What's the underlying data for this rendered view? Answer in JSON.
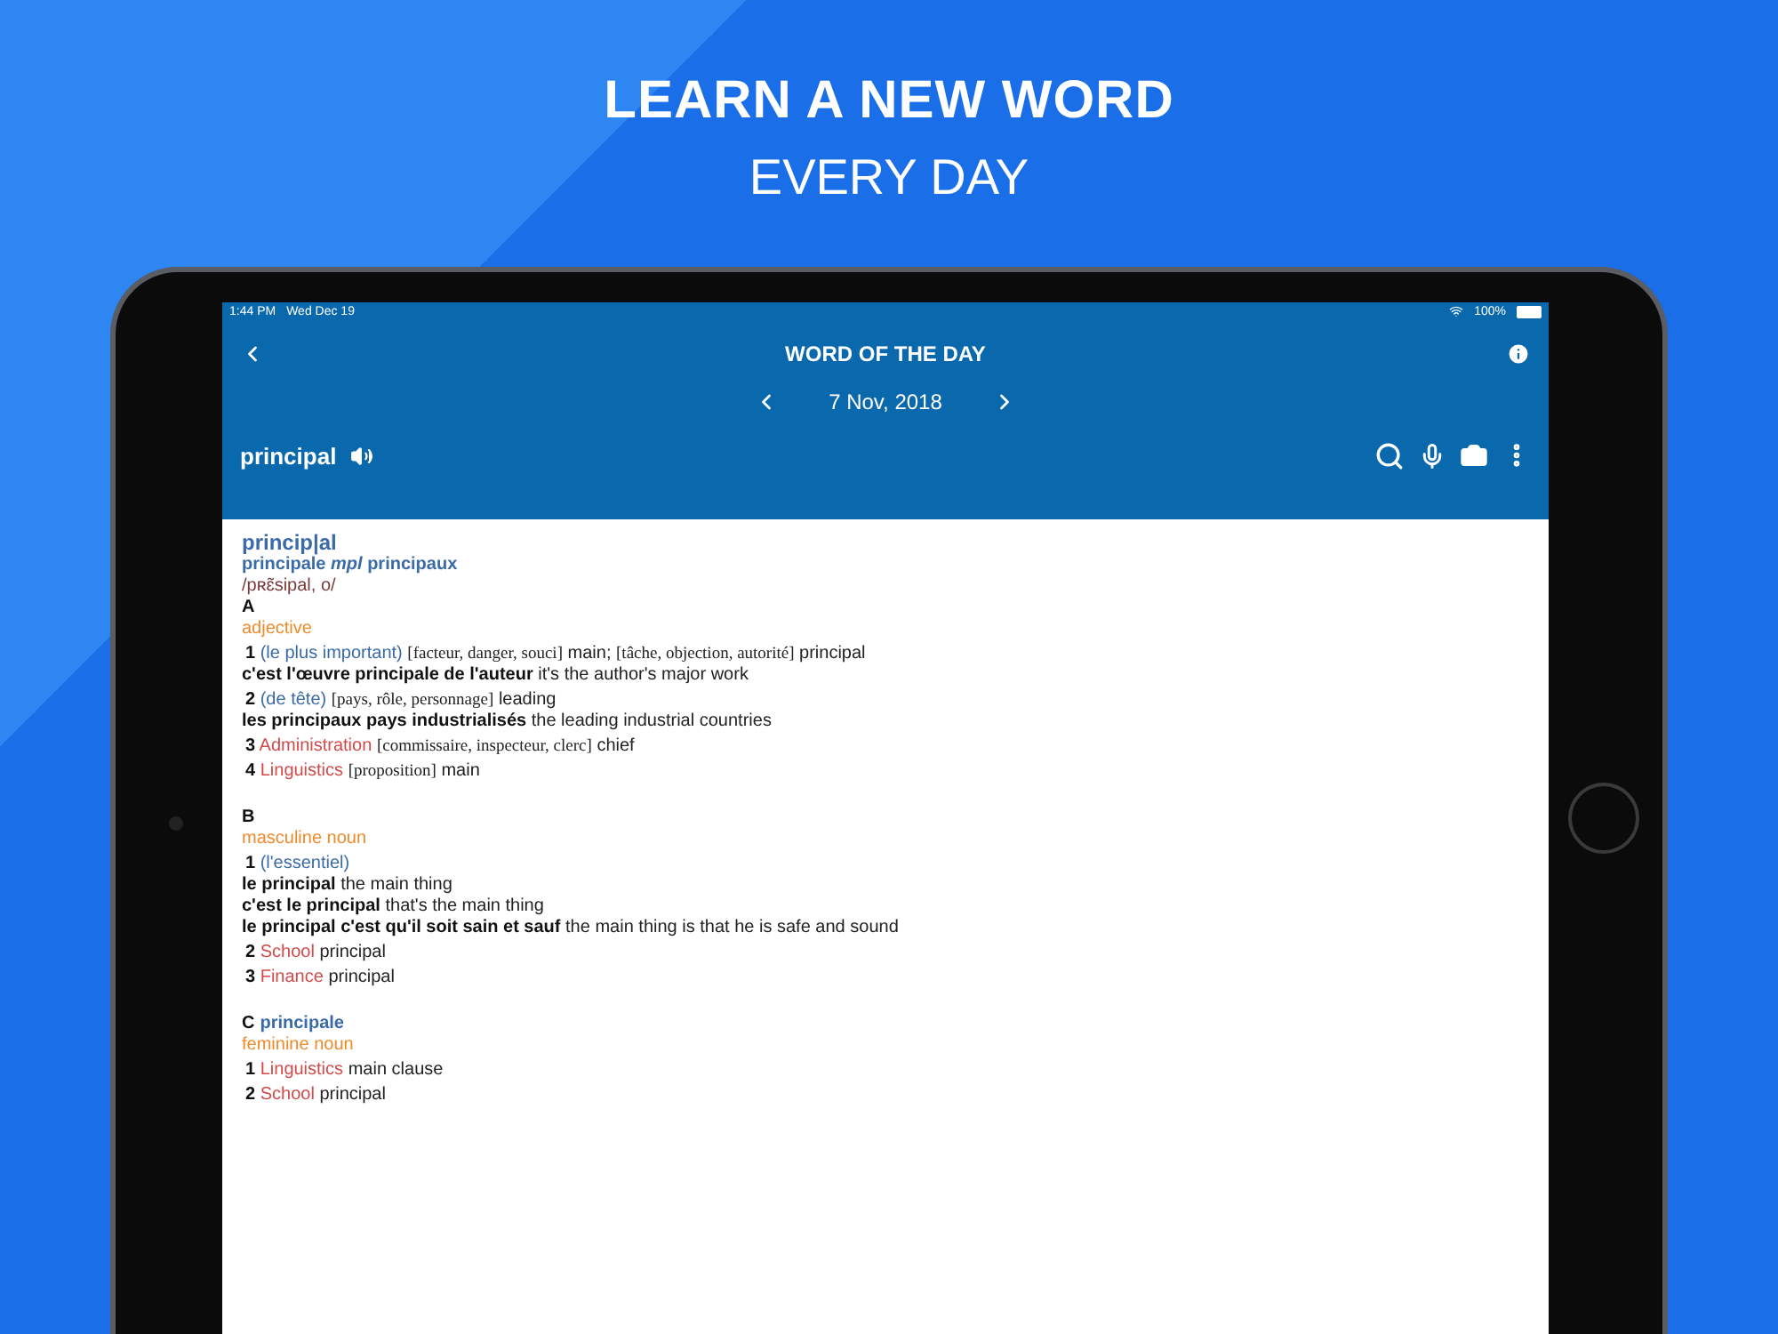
{
  "headline": {
    "title": "LEARN A NEW WORD",
    "subtitle": "EVERY DAY"
  },
  "status_bar": {
    "time": "1:44 PM",
    "date": "Wed Dec 19",
    "battery": "100%"
  },
  "app_bar": {
    "title": "WORD OF THE DAY",
    "date": "7 Nov, 2018",
    "word": "principal"
  },
  "entry": {
    "headword": "princip|al",
    "forms": "principale *mpl* principaux",
    "pronunciation": "/pʀɛ̃sipal, o/",
    "blocks": [
      {
        "letter": "A",
        "pos": "adjective",
        "lines": [
          {
            "kind": "sense",
            "segments": [
              {
                "kind": "num",
                "text": "1"
              },
              {
                "kind": "gloss",
                "text": "(le plus important)"
              },
              {
                "kind": "context",
                "text": "[facteur, danger, souci]"
              },
              {
                "kind": "text",
                "text": "main;"
              },
              {
                "kind": "context",
                "text": "[tâche, objection, autorité]"
              },
              {
                "kind": "text",
                "text": "principal"
              }
            ]
          },
          {
            "kind": "example",
            "segments": [
              {
                "kind": "phrase",
                "text": "c'est l'œuvre principale de l'auteur"
              },
              {
                "kind": "text",
                "text": "it's the author's major work"
              }
            ]
          },
          {
            "kind": "sense",
            "segments": [
              {
                "kind": "num",
                "text": "2"
              },
              {
                "kind": "gloss",
                "text": "(de tête)"
              },
              {
                "kind": "context",
                "text": "[pays, rôle, personnage]"
              },
              {
                "kind": "text",
                "text": "leading"
              }
            ]
          },
          {
            "kind": "example",
            "segments": [
              {
                "kind": "phrase",
                "text": "les principaux pays industrialisés"
              },
              {
                "kind": "text",
                "text": "the leading industrial countries"
              }
            ]
          },
          {
            "kind": "sense",
            "segments": [
              {
                "kind": "num",
                "text": "3"
              },
              {
                "kind": "field",
                "text": "Administration"
              },
              {
                "kind": "context",
                "text": "[commissaire, inspecteur, clerc]"
              },
              {
                "kind": "text",
                "text": "chief"
              }
            ]
          },
          {
            "kind": "sense",
            "segments": [
              {
                "kind": "num",
                "text": "4"
              },
              {
                "kind": "field",
                "text": "Linguistics"
              },
              {
                "kind": "context",
                "text": "[proposition]"
              },
              {
                "kind": "text",
                "text": "main"
              }
            ]
          }
        ]
      },
      {
        "letter": "B",
        "pos": "masculine noun",
        "lines": [
          {
            "kind": "sense",
            "segments": [
              {
                "kind": "num",
                "text": "1"
              },
              {
                "kind": "gloss",
                "text": "(l'essentiel)"
              }
            ]
          },
          {
            "kind": "example",
            "segments": [
              {
                "kind": "phrase",
                "text": "le principal"
              },
              {
                "kind": "text",
                "text": "the main thing"
              }
            ]
          },
          {
            "kind": "example",
            "segments": [
              {
                "kind": "phrase",
                "text": "c'est le principal"
              },
              {
                "kind": "text",
                "text": "that's the main thing"
              }
            ]
          },
          {
            "kind": "example",
            "segments": [
              {
                "kind": "phrase",
                "text": "le principal c'est qu'il soit sain et sauf"
              },
              {
                "kind": "text",
                "text": "the main thing is that he is safe and sound"
              }
            ]
          },
          {
            "kind": "sense",
            "segments": [
              {
                "kind": "num",
                "text": "2"
              },
              {
                "kind": "field",
                "text": "School"
              },
              {
                "kind": "text",
                "text": "principal"
              }
            ]
          },
          {
            "kind": "sense",
            "segments": [
              {
                "kind": "num",
                "text": "3"
              },
              {
                "kind": "field",
                "text": "Finance"
              },
              {
                "kind": "text",
                "text": "principal"
              }
            ]
          }
        ]
      },
      {
        "letter": "C",
        "word": "principale",
        "pos": "feminine noun",
        "lines": [
          {
            "kind": "sense",
            "segments": [
              {
                "kind": "num",
                "text": "1"
              },
              {
                "kind": "field",
                "text": "Linguistics"
              },
              {
                "kind": "text",
                "text": "main clause"
              }
            ]
          },
          {
            "kind": "sense",
            "segments": [
              {
                "kind": "num",
                "text": "2"
              },
              {
                "kind": "field",
                "text": "School"
              },
              {
                "kind": "text",
                "text": "principal"
              }
            ]
          }
        ]
      }
    ]
  }
}
